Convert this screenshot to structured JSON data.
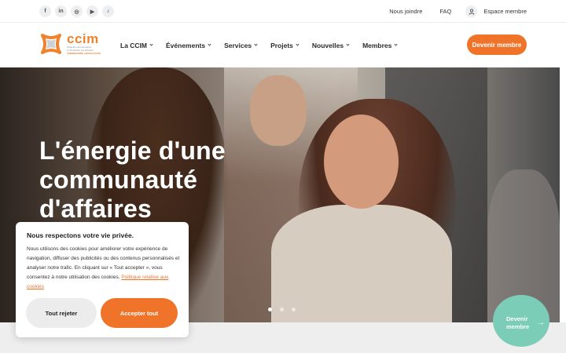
{
  "topbar": {
    "socials": [
      {
        "icon": "facebook-icon",
        "glyph": "f"
      },
      {
        "icon": "linkedin-icon",
        "glyph": "in"
      },
      {
        "icon": "instagram-icon",
        "glyph": "◎"
      },
      {
        "icon": "youtube-icon",
        "glyph": "▶"
      },
      {
        "icon": "tiktok-icon",
        "glyph": "♪"
      }
    ],
    "contact": "Nous joindre",
    "faq": "FAQ",
    "member_space": "Espace membre"
  },
  "header": {
    "logo": {
      "word": "ccim",
      "sub1": "Chambre de commerce",
      "sub2": "et d'industrie Les Moulins",
      "tag": "TERREBONNE | MASCOUCHE"
    },
    "nav": [
      "La CCIM",
      "Événements",
      "Services",
      "Projets",
      "Nouvelles",
      "Membres"
    ],
    "cta": "Devenir membre"
  },
  "hero": {
    "title_line1": "L'énergie d'une",
    "title_line2": "communauté",
    "title_line3": "d'affaires",
    "slides": 3,
    "active_slide": 0
  },
  "float_cta": {
    "line1": "Devenir",
    "line2": "membre",
    "arrow": "→"
  },
  "cookie": {
    "title": "Nous respectons votre vie privée.",
    "text": "Nous utilisons des cookies pour améliorer votre expérience de navigation, diffuser des publicités ou des contenus personnalisés et analyser notre trafic. En cliquant sur « Tout accepter », vous consentez à notre utilisation des cookies.",
    "link": "Politique relative aux cookies",
    "reject": "Tout rejeter",
    "accept": "Accepter tout"
  },
  "colors": {
    "brand_orange": "#f0732a",
    "teal": "#7ccdb8"
  }
}
